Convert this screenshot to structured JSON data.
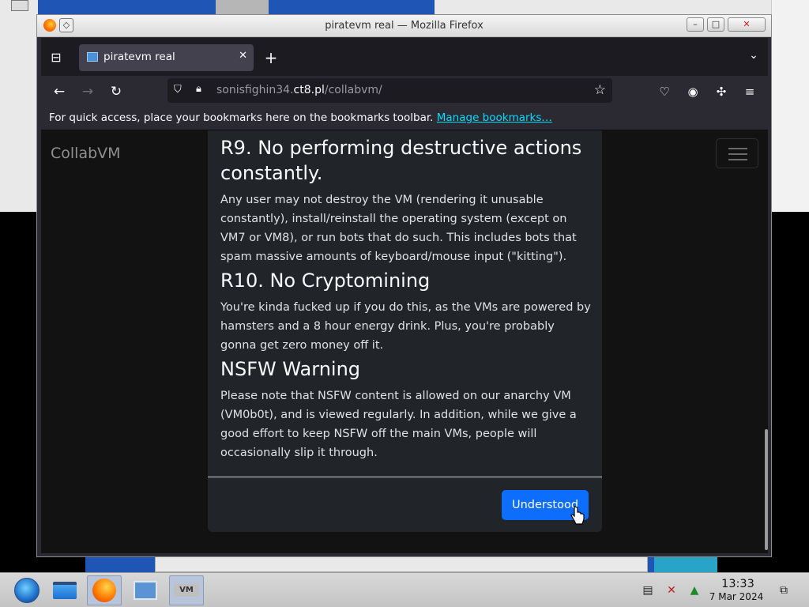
{
  "window": {
    "title": "piratevm real — Mozilla Firefox",
    "controls": {
      "minimize": "–",
      "maximize": "□",
      "close": "✕"
    }
  },
  "tabs": [
    {
      "title": "piratevm real",
      "favicon": "monitor-icon",
      "active": true
    }
  ],
  "toolbar": {
    "url_host": "sonisfighin34.",
    "url_domain": "ct8.pl",
    "url_path": "/collabvm/"
  },
  "bookmarks_bar": {
    "prompt": "For quick access, place your bookmarks here on the bookmarks toolbar.",
    "link": "Manage bookmarks…"
  },
  "site": {
    "brand": "CollabVM"
  },
  "modal": {
    "rules": [
      {
        "heading": "R9. No performing destructive actions constantly.",
        "text": "Any user may not destroy the VM (rendering it unusable constantly), install/reinstall the operating system (except on VM7 or VM8), or run bots that do such. This includes bots that spam massive amounts of keyboard/mouse input (\"kitting\")."
      },
      {
        "heading": "R10. No Cryptomining",
        "text": "You're kinda fucked up if you do this, as the VMs are powered by hamsters and a 8 hour energy drink. Plus, you're probably gonna get zero money off it."
      },
      {
        "heading": "NSFW Warning",
        "text": "Please note that NSFW content is allowed on our anarchy VM (VM0b0t), and is viewed regularly. In addition, while we give a good effort to keep NSFW off the main VMs, people will occasionally slip it through."
      }
    ],
    "confirm_label": "Understood"
  },
  "taskbar": {
    "clock_time": "13:33",
    "clock_date": "7 Mar 2024",
    "vm_label": "VM"
  },
  "colors": {
    "accent_button": "#0d6efd",
    "modal_bg": "#212529",
    "page_bg": "#121212",
    "link": "#00ddff"
  }
}
